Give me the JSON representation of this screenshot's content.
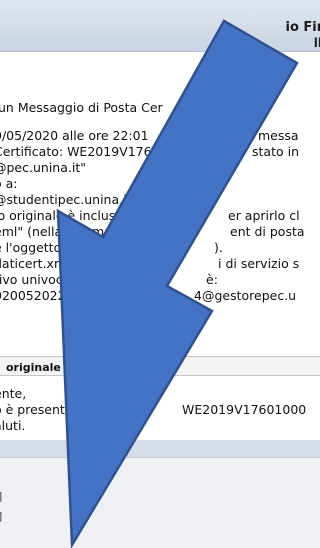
{
  "header": {
    "sender_fragment": "io Fin",
    "sender_fragment2": "ll"
  },
  "message": {
    "lines": [
      "un Messaggio di Posta Cer",
      "0/05/2020 alle ore 22:01",
      "messa",
      "Certificato: WE2019V176",
      "stato in",
      "@pec.unina.it\"",
      "o a:",
      "@studentipec.unina.it",
      "io originale è incluso",
      "er aprirlo cl",
      "eml\" (nella webmai",
      "ent di posta",
      "e l'oggetto del mes",
      ").",
      "daticert.xml contie",
      "i di servizio s",
      "tivo univoco di qu",
      "è:",
      "0200520220149",
      "4@gestorepec.u"
    ],
    "original_label": "originale",
    "body_lines": [
      "ente,",
      "o è presente",
      "WE2019V17601000",
      "aluti."
    ]
  },
  "footer": {
    "items": [
      "]",
      "]"
    ]
  },
  "colors": {
    "arrow_fill": "#4472c4",
    "arrow_stroke": "#2f528f"
  }
}
